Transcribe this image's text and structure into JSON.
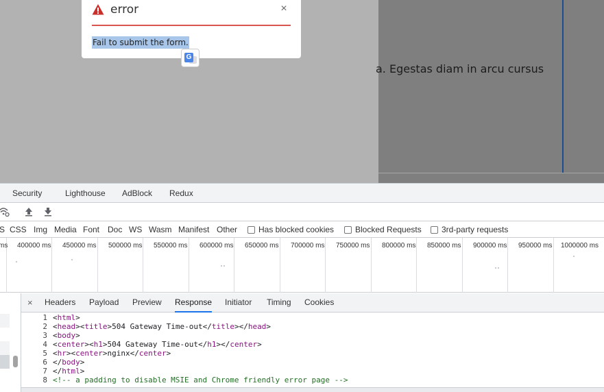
{
  "page": {
    "background_text": "a. Egestas diam in arcu cursus"
  },
  "modal": {
    "title": "error",
    "close_symbol": "×",
    "message": "Fail to submit the form.",
    "accent_color": "#d9534f"
  },
  "devtools": {
    "panel_tabs": [
      "Security",
      "Lighthouse",
      "AdBlock",
      "Redux"
    ],
    "filter_types": [
      "S",
      "CSS",
      "Img",
      "Media",
      "Font",
      "Doc",
      "WS",
      "Wasm",
      "Manifest",
      "Other"
    ],
    "filter_checks": [
      "Has blocked cookies",
      "Blocked Requests",
      "3rd-party requests"
    ],
    "timeline_labels": [
      "ms",
      "400000 ms",
      "450000 ms",
      "500000 ms",
      "550000 ms",
      "600000 ms",
      "650000 ms",
      "700000 ms",
      "750000 ms",
      "800000 ms",
      "850000 ms",
      "900000 ms",
      "950000 ms",
      "1000000 ms"
    ],
    "detail_close": "×",
    "detail_tabs": [
      "Headers",
      "Payload",
      "Preview",
      "Response",
      "Initiator",
      "Timing",
      "Cookies"
    ],
    "active_detail_tab": "Response",
    "icons": [
      "wifi-settings-icon",
      "upload-icon",
      "download-icon",
      "warning-icon",
      "translate-icon"
    ]
  },
  "response": {
    "lines": [
      {
        "n": "1",
        "text": "<html>"
      },
      {
        "n": "2",
        "text": "<head><title>504 Gateway Time-out</title></head>"
      },
      {
        "n": "3",
        "text": "<body>"
      },
      {
        "n": "4",
        "text": "<center><h1>504 Gateway Time-out</h1></center>"
      },
      {
        "n": "5",
        "text": "<hr><center>nginx</center>"
      },
      {
        "n": "6",
        "text": "</body>"
      },
      {
        "n": "7",
        "text": "</html>"
      },
      {
        "n": "8",
        "text": "<!-- a padding to disable MSIE and Chrome friendly error page -->"
      }
    ]
  }
}
